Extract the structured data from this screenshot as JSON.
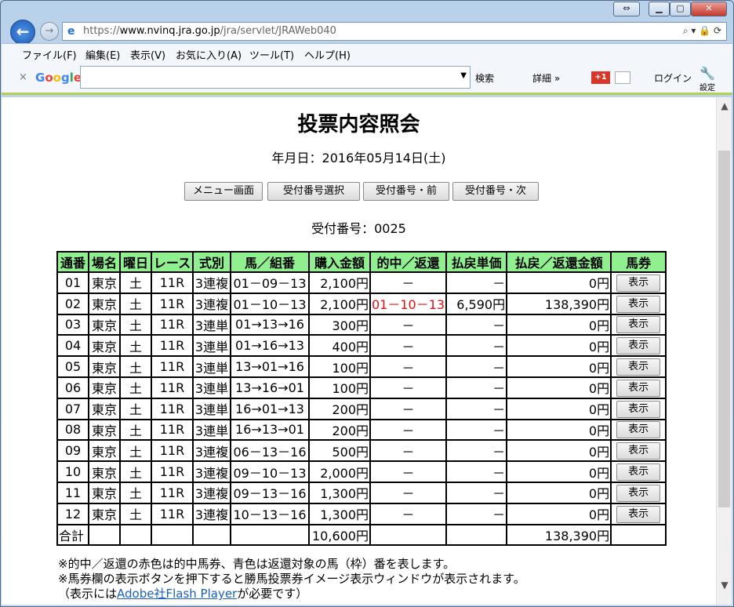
{
  "browser": {
    "url_scheme": "https://",
    "url_host": "www.nvinq.jra.go.jp",
    "url_path": "/jra/servlet/JRAWeb040",
    "addr_tools": "⌕ ▾ 🔒 ⟳",
    "back_icon": "←",
    "forward_icon": "→"
  },
  "menu": [
    "ファイル(F)",
    "編集(E)",
    "表示(V)",
    "お気に入り(A)",
    "ツール(T)",
    "ヘルプ(H)"
  ],
  "gtoolbar": {
    "close": "×",
    "logo": "Google",
    "search_btn": "検索",
    "more": "詳細 »",
    "plus": "+1",
    "login": "ログイン",
    "settings": "設定"
  },
  "page": {
    "title": "投票内容照会",
    "date_line": "年月日：2016年05月14日(土)",
    "buttons": [
      "メニュー画面",
      "受付番号選択",
      "受付番号・前",
      "受付番号・次"
    ],
    "receipt_line": "受付番号：0025"
  },
  "table": {
    "headers": [
      "通番",
      "場名",
      "曜日",
      "レース",
      "式別",
      "馬／組番",
      "購入金額",
      "的中／返還",
      "払戻単価",
      "払戻／返還金額",
      "馬券"
    ],
    "rows": [
      [
        "01",
        "東京",
        "土",
        "11R",
        "3連複",
        "01－09－13",
        "2,100円",
        "－",
        "－",
        "0円",
        "表示"
      ],
      [
        "02",
        "東京",
        "土",
        "11R",
        "3連複",
        "01－10－13",
        "2,100円",
        "01－10－13",
        "6,590円",
        "138,390円",
        "表示"
      ],
      [
        "03",
        "東京",
        "土",
        "11R",
        "3連単",
        "01→13→16",
        "300円",
        "－",
        "－",
        "0円",
        "表示"
      ],
      [
        "04",
        "東京",
        "土",
        "11R",
        "3連単",
        "01→16→13",
        "400円",
        "－",
        "－",
        "0円",
        "表示"
      ],
      [
        "05",
        "東京",
        "土",
        "11R",
        "3連単",
        "13→01→16",
        "100円",
        "－",
        "－",
        "0円",
        "表示"
      ],
      [
        "06",
        "東京",
        "土",
        "11R",
        "3連単",
        "13→16→01",
        "100円",
        "－",
        "－",
        "0円",
        "表示"
      ],
      [
        "07",
        "東京",
        "土",
        "11R",
        "3連単",
        "16→01→13",
        "200円",
        "－",
        "－",
        "0円",
        "表示"
      ],
      [
        "08",
        "東京",
        "土",
        "11R",
        "3連単",
        "16→13→01",
        "200円",
        "－",
        "－",
        "0円",
        "表示"
      ],
      [
        "09",
        "東京",
        "土",
        "11R",
        "3連複",
        "06－13－16",
        "500円",
        "－",
        "－",
        "0円",
        "表示"
      ],
      [
        "10",
        "東京",
        "土",
        "11R",
        "3連複",
        "09－10－13",
        "2,000円",
        "－",
        "－",
        "0円",
        "表示"
      ],
      [
        "11",
        "東京",
        "土",
        "11R",
        "3連複",
        "09－13－16",
        "1,300円",
        "－",
        "－",
        "0円",
        "表示"
      ],
      [
        "12",
        "東京",
        "土",
        "11R",
        "3連複",
        "10－13－16",
        "1,300円",
        "－",
        "－",
        "0円",
        "表示"
      ]
    ],
    "total_label": "合計",
    "total_purchase": "10,600円",
    "total_payout": "138,390円"
  },
  "notes": {
    "line1": "※的中／返還の赤色は的中馬券、青色は返還対象の馬（枠）番を表します。",
    "line2": "※馬券欄の表示ボタンを押下すると勝馬投票券イメージ表示ウィンドウが表示されます。",
    "line3_pre": "（表示には",
    "line3_link": "Adobe社Flash Player",
    "line3_post": "が必要です）"
  },
  "colors": {
    "header_green": "#90f090",
    "hit_red": "#e01010",
    "link_blue": "#1a5fc4"
  }
}
